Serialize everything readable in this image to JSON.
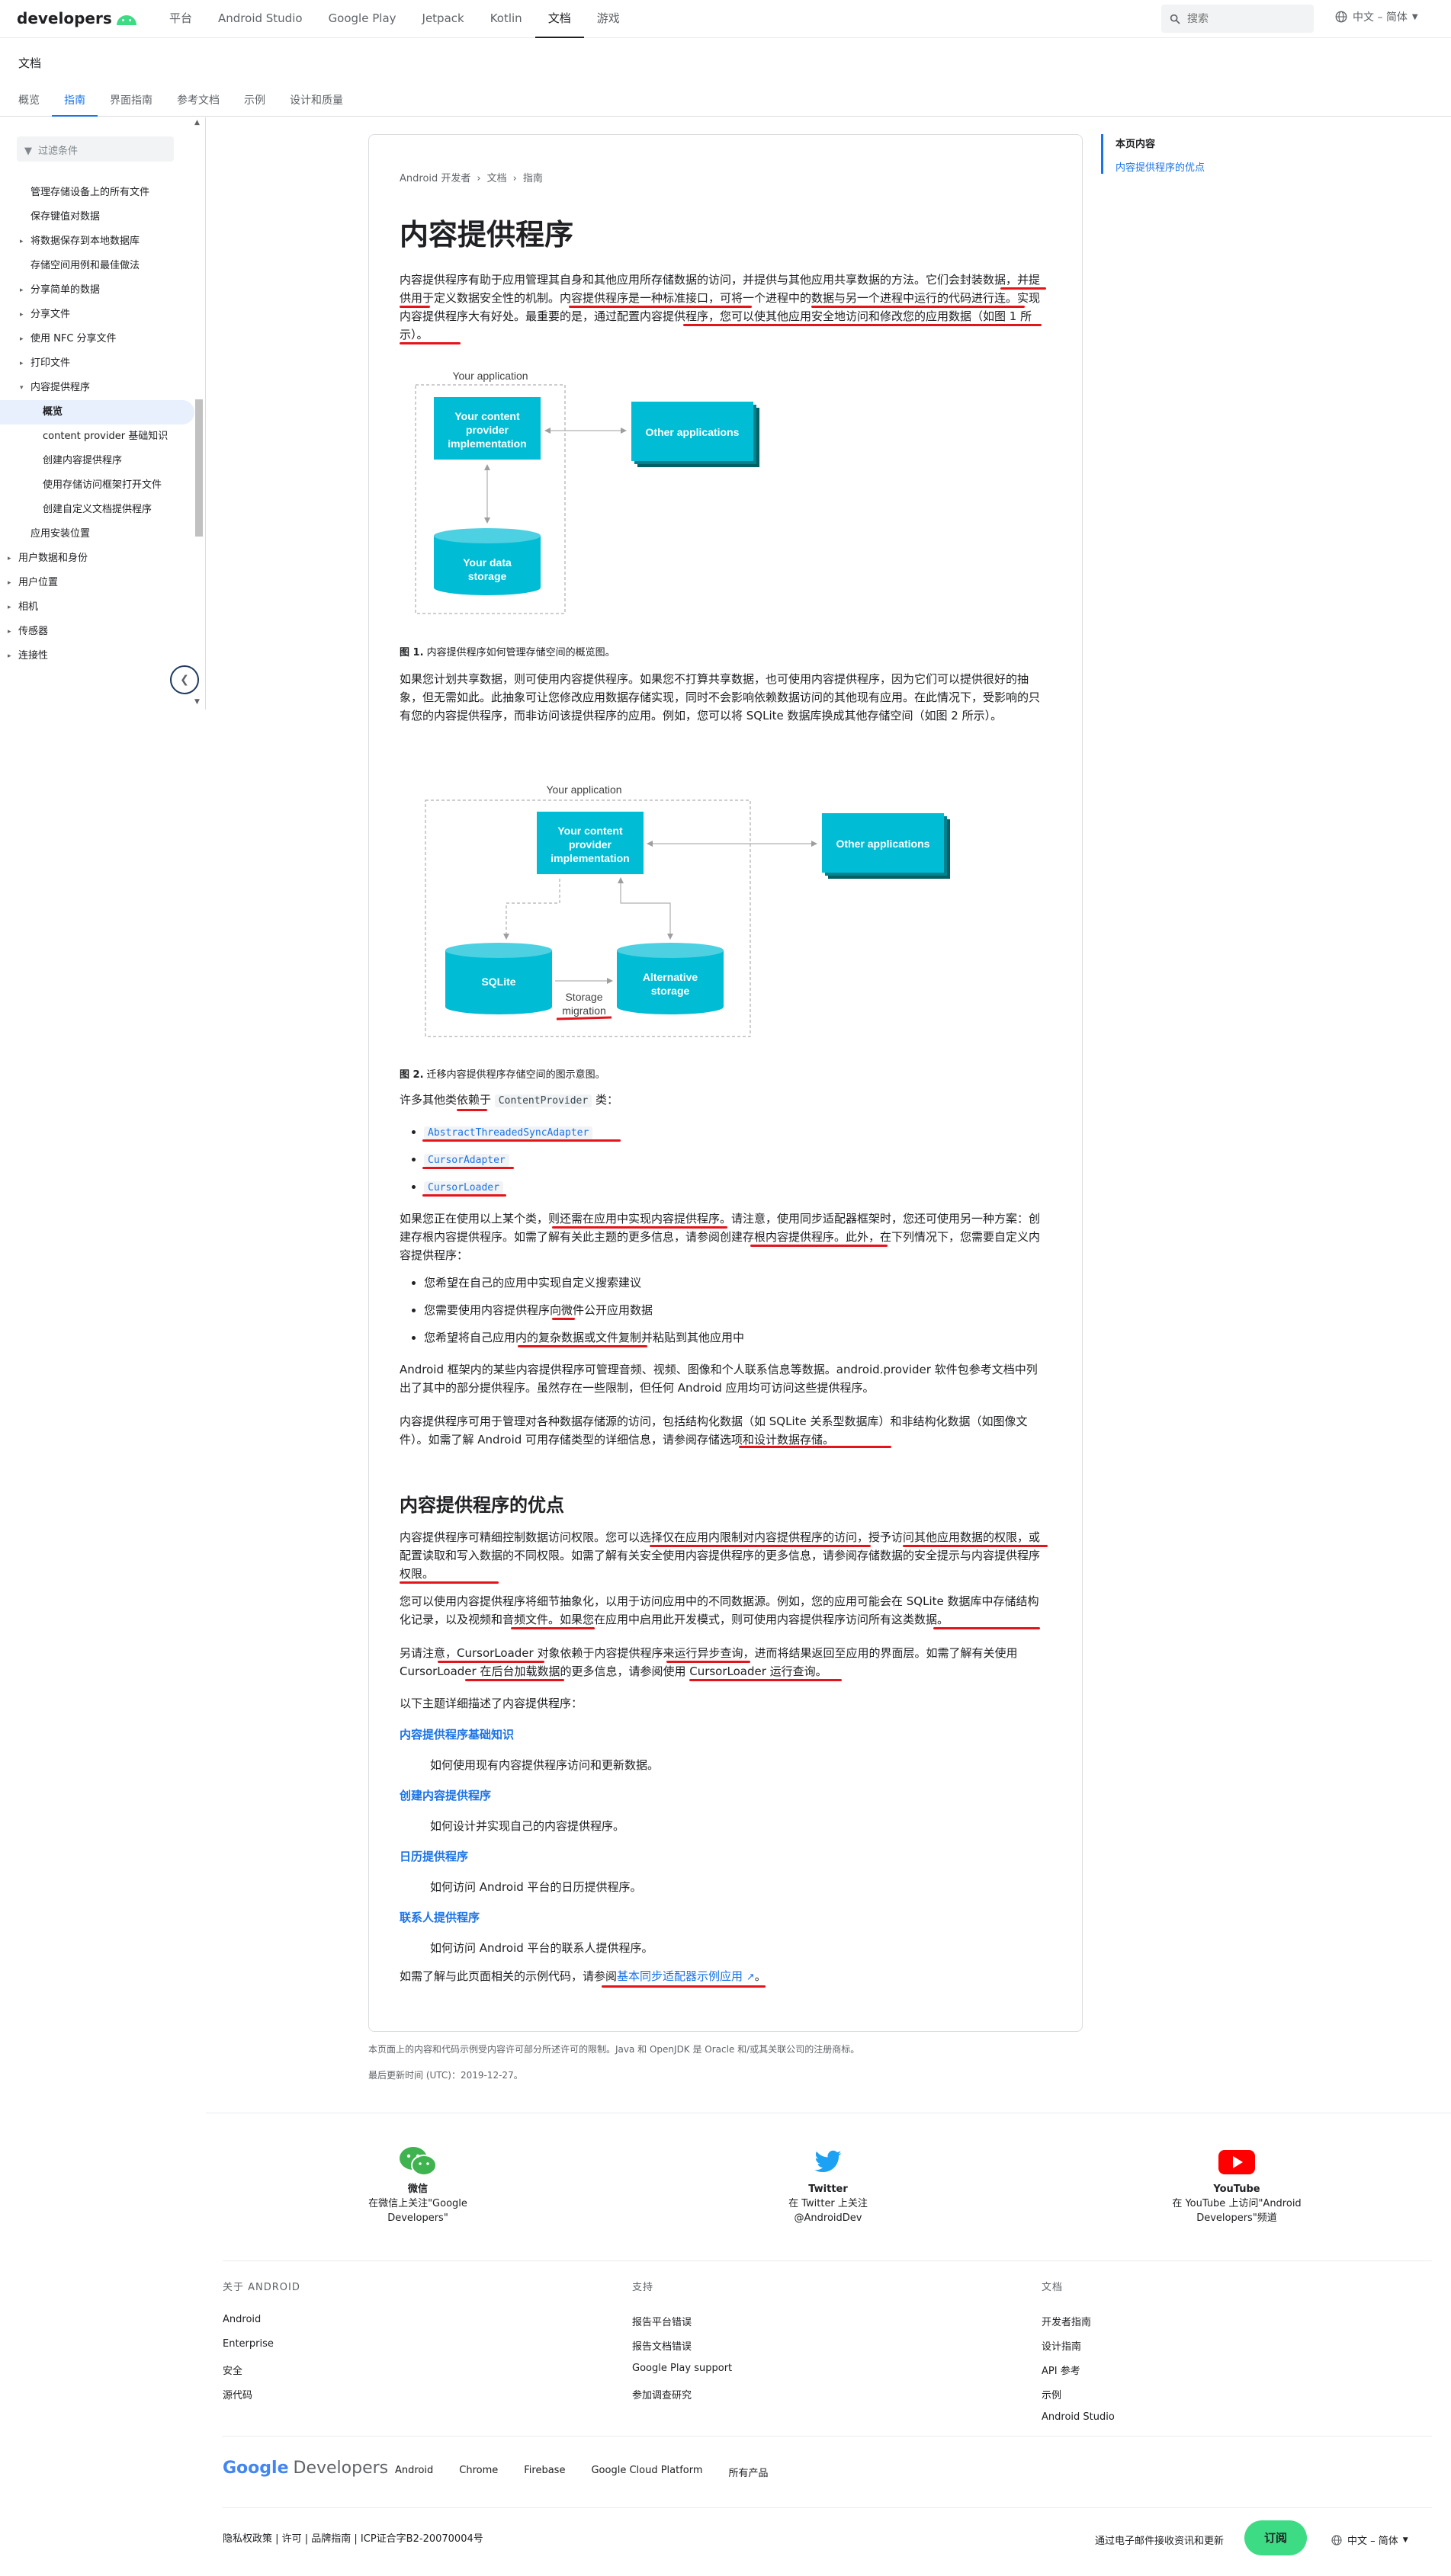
{
  "topbar": {
    "logo": "developers",
    "nav": [
      "平台",
      "Android Studio",
      "Google Play",
      "Jetpack",
      "Kotlin",
      "文档",
      "游戏"
    ],
    "active_nav": "文档",
    "search_placeholder": "搜索",
    "language": "中文 – 简体"
  },
  "subheader": {
    "title": "文档",
    "tabs": [
      "概览",
      "指南",
      "界面指南",
      "参考文档",
      "示例",
      "设计和质量"
    ],
    "active_tab": "指南"
  },
  "sidebar": {
    "filter_placeholder": "过滤条件",
    "items": [
      {
        "label": "管理存储设备上的所有文件",
        "level": 1,
        "caret": ""
      },
      {
        "label": "保存键值对数据",
        "level": 1,
        "caret": ""
      },
      {
        "label": "将数据保存到本地数据库",
        "level": 1,
        "caret": "▸"
      },
      {
        "label": "存储空间用例和最佳做法",
        "level": 1,
        "caret": ""
      },
      {
        "label": "分享简单的数据",
        "level": 1,
        "caret": "▸"
      },
      {
        "label": "分享文件",
        "level": 1,
        "caret": "▸"
      },
      {
        "label": "使用 NFC 分享文件",
        "level": 1,
        "caret": "▸"
      },
      {
        "label": "打印文件",
        "level": 1,
        "caret": "▸"
      },
      {
        "label": "内容提供程序",
        "level": 1,
        "caret": "▾"
      },
      {
        "label": "概览",
        "level": 2,
        "caret": "",
        "active": true
      },
      {
        "label": "content provider 基础知识",
        "level": 2,
        "caret": ""
      },
      {
        "label": "创建内容提供程序",
        "level": 2,
        "caret": ""
      },
      {
        "label": "使用存储访问框架打开文件",
        "level": 2,
        "caret": ""
      },
      {
        "label": "创建自定义文档提供程序",
        "level": 2,
        "caret": ""
      },
      {
        "label": "应用安装位置",
        "level": 1,
        "caret": ""
      },
      {
        "label": "用户数据和身份",
        "level": 0,
        "caret": "▸"
      },
      {
        "label": "用户位置",
        "level": 0,
        "caret": "▸"
      },
      {
        "label": "相机",
        "level": 0,
        "caret": "▸"
      },
      {
        "label": "传感器",
        "level": 0,
        "caret": "▸"
      },
      {
        "label": "连接性",
        "level": 0,
        "caret": "▸"
      }
    ]
  },
  "breadcrumb": [
    "Android 开发者",
    "文档",
    "指南"
  ],
  "article": {
    "title": "内容提供程序",
    "intro": "内容提供程序有助于应用管理其自身和其他应用所存储数据的访问，并提供与其他应用共享数据的方法。它们会封装数据，并提供用于定义数据安全性的机制。内容提供程序是一种标准接口，可将一个进程中的数据与另一个进程中运行的代码进行连。实现内容提供程序大有好处。最重要的是，通过配置内容提供程序，您可以使其他应用安全地访问和修改您的应用数据（如图 1 所示）。",
    "fig1": {
      "app_label": "Your application",
      "provider": "Your content provider implementation",
      "other": "Other applications",
      "storage": "Your data storage",
      "caption_bold": "图 1.",
      "caption": "内容提供程序如何管理存储空间的概览图。"
    },
    "para2": "如果您计划共享数据，则可使用内容提供程序。如果您不打算共享数据，也可使用内容提供程序，因为它们可以提供很好的抽象，但无需如此。此抽象可让您修改应用数据存储实现，同时不会影响依赖数据访问的其他现有应用。在此情况下，受影响的只有您的内容提供程序，而非访问该提供程序的应用。例如，您可以将 SQLite 数据库换成其他存储空间（如图 2 所示）。",
    "fig2": {
      "app_label": "Your application",
      "provider": "Your content provider implementation",
      "other": "Other applications",
      "sqlite": "SQLite",
      "alt": "Alternative storage",
      "migration": "Storage migration",
      "caption_bold": "图 2.",
      "caption": "迁移内容提供程序存储空间的图示意图。"
    },
    "classes_intro_a": "许多其他类依赖于",
    "classes_intro_code": "ContentProvider",
    "classes_intro_b": "类：",
    "classes": [
      "AbstractThreadedSyncAdapter",
      "CursorAdapter",
      "CursorLoader"
    ],
    "para3": "如果您正在使用以上某个类，则还需在应用中实现内容提供程序。请注意，使用同步适配器框架时，您还可使用另一种方案：创建存根内容提供程序。如需了解有关此主题的更多信息，请参阅创建存根内容提供程序。此外，在下列情况下，您需要自定义内容提供程序：",
    "reasons": [
      "您希望在自己的应用中实现自定义搜索建议",
      "您需要使用内容提供程序向微件公开应用数据",
      "您希望将自己应用内的复杂数据或文件复制并粘贴到其他应用中"
    ],
    "para4": "Android 框架内的某些内容提供程序可管理音频、视频、图像和个人联系信息等数据。android.provider 软件包参考文档中列出了其中的部分提供程序。虽然存在一些限制，但任何 Android 应用均可访问这些提供程序。",
    "para5": "内容提供程序可用于管理对各种数据存储源的访问，包括结构化数据（如 SQLite 关系型数据库）和非结构化数据（如图像文件）。如需了解 Android 可用存储类型的详细信息，请参阅存储选项和设计数据存储。",
    "h2": "内容提供程序的优点",
    "para6": "内容提供程序可精细控制数据访问权限。您可以选择仅在应用内限制对内容提供程序的访问，授予访问其他应用数据的权限，或配置读取和写入数据的不同权限。如需了解有关安全使用内容提供程序的更多信息，请参阅存储数据的安全提示与内容提供程序权限。",
    "para7": "您可以使用内容提供程序将细节抽象化，以用于访问应用中的不同数据源。例如，您的应用可能会在 SQLite 数据库中存储结构化记录，以及视频和音频文件。如果您在应用中启用此开发模式，则可使用内容提供程序访问所有这类数据。",
    "para8": "另请注意，CursorLoader 对象依赖于内容提供程序来运行异步查询，进而将结果返回至应用的界面层。如需了解有关使用 CursorLoader 在后台加载数据的更多信息，请参阅使用 CursorLoader 运行查询。",
    "topics_intro": "以下主题详细描述了内容提供程序：",
    "topics": [
      {
        "title": "内容提供程序基础知识",
        "desc": "如何使用现有内容提供程序访问和更新数据。"
      },
      {
        "title": "创建内容提供程序",
        "desc": "如何设计并实现自己的内容提供程序。"
      },
      {
        "title": "日历提供程序",
        "desc": "如何访问 Android 平台的日历提供程序。"
      },
      {
        "title": "联系人提供程序",
        "desc": "如何访问 Android 平台的联系人提供程序。"
      }
    ],
    "sample_a": "如需了解与此页面相关的示例代码，请参阅",
    "sample_link": "基本同步适配器示例应用",
    "sample_b": "。"
  },
  "toc": {
    "title": "本页内容",
    "items": [
      "内容提供程序的优点"
    ]
  },
  "license": "本页面上的内容和代码示例受内容许可部分所述许可的限制。Java 和 OpenJDK 是 Oracle 和/或其关联公司的注册商标。",
  "last_updated": "最后更新时间 (UTC)：2019-12-27。",
  "social": [
    {
      "name": "微信",
      "desc": "在微信上关注\"Google Developers\"",
      "color": "#3eb34f"
    },
    {
      "name": "Twitter",
      "desc": "在 Twitter 上关注 @AndroidDev",
      "color": "#1da1f2"
    },
    {
      "name": "YouTube",
      "desc": "在 YouTube 上访问\"Android Developers\"频道",
      "color": "#ff0000"
    }
  ],
  "footer": {
    "cols": [
      {
        "heading": "关于 ANDROID",
        "links": [
          "Android",
          "Enterprise",
          "安全",
          "源代码"
        ]
      },
      {
        "heading": "支持",
        "links": [
          "报告平台错误",
          "报告文档错误",
          "Google Play support",
          "参加调查研究"
        ]
      },
      {
        "heading": "文档",
        "links": [
          "开发者指南",
          "设计指南",
          "API 参考",
          "示例",
          "Android Studio"
        ]
      }
    ],
    "brand_google": "Google",
    "brand_dev": "Developers",
    "links": [
      "Android",
      "Chrome",
      "Firebase",
      "Google Cloud Platform",
      "所有产品"
    ],
    "bottom": "隐私权政策 | 许可 | 品牌指南 | ICP证合字B2-20070004号",
    "subscribe_text": "通过电子邮件接收资讯和更新",
    "subscribe_btn": "订阅",
    "language": "中文 – 简体"
  }
}
